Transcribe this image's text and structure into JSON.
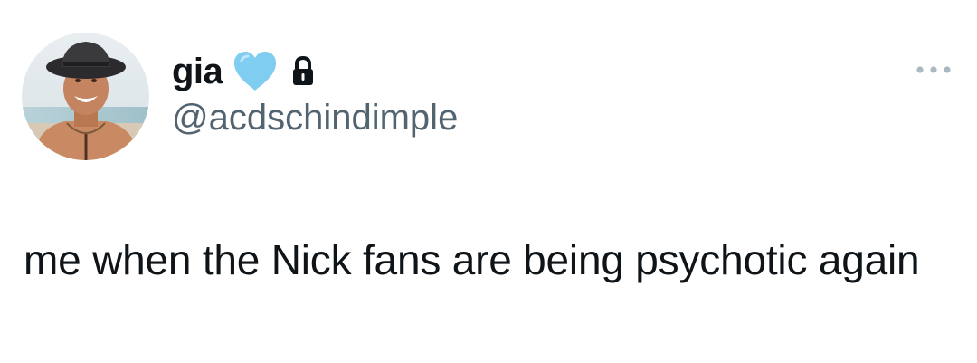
{
  "tweet": {
    "author": {
      "display_name": "gia",
      "handle": "@acdschindimple",
      "avatar_icon": "user-avatar-photo",
      "emoji_icon": "light-blue-heart-icon",
      "protected_icon": "lock-icon"
    },
    "more_icon": "more-dots-icon",
    "text": "me when the Nick fans are being psychotic again"
  },
  "colors": {
    "text_primary": "#0f1419",
    "text_secondary": "#536471",
    "heart": "#7fcdf0",
    "more_dots": "#aab8c2"
  }
}
